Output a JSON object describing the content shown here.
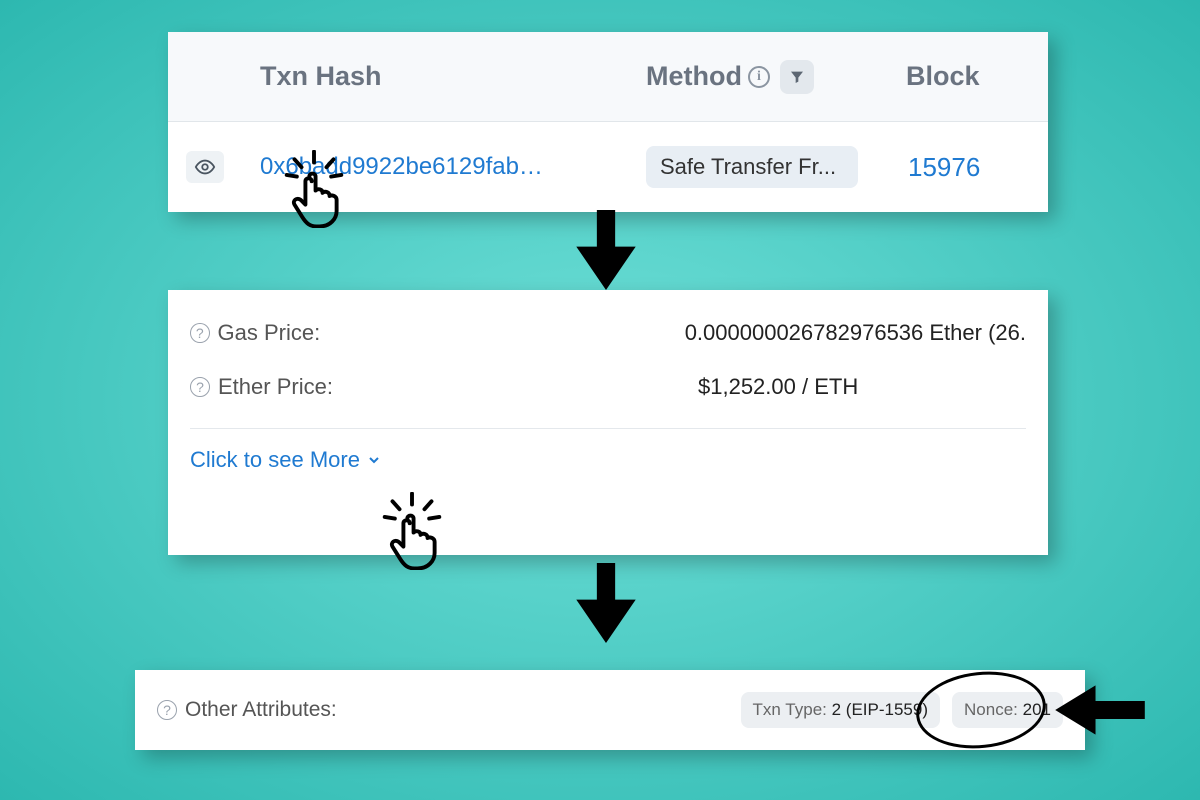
{
  "panel1": {
    "headers": {
      "txn": "Txn Hash",
      "method": "Method",
      "block": "Block"
    },
    "row": {
      "hash": "0x6badd9922be6129fab…",
      "method": "Safe Transfer Fr...",
      "block": "15976"
    }
  },
  "panel2": {
    "rows": [
      {
        "label": "Gas Price:",
        "value": "0.000000026782976536 Ether (26."
      },
      {
        "label": "Ether Price:",
        "value": "$1,252.00 / ETH"
      }
    ],
    "more": "Click to see More"
  },
  "panel3": {
    "label": "Other Attributes:",
    "txnTypeLabel": "Txn Type:",
    "txnTypeValue": "2 (EIP-1559)",
    "nonceLabel": "Nonce:",
    "nonceValue": "201"
  }
}
